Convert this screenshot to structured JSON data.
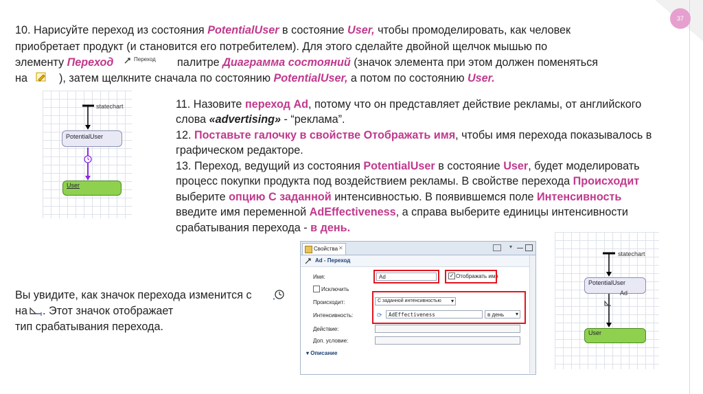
{
  "page": {
    "number": "37"
  },
  "paragraph10": {
    "l1a": "10. Нарисуйте переход из состояния ",
    "l1b": "PotentialUser",
    "l1c": " в состояние ",
    "l1d": "User,",
    "l1e": " чтобы промоделировать, как человек",
    "l2": "приобретает продукт (и становится его потребителем). Для этого сделайте двойной щелчок мышью по",
    "l3a": "элементу ",
    "l3b": "Переход",
    "l3c": "палитре ",
    "l3d": "Диаграмма состояний",
    "l3e": " (значок элемента при этом должен поменяться",
    "l4a": "на",
    "l4b": "), затем щелкните сначала по состоянию ",
    "l4c": "PotentialUser,",
    "l4d": " а потом по состоянию ",
    "l4e": "User."
  },
  "palette": {
    "label": "Переход",
    "icon": "transition-icon",
    "pencil_icon": "pencil-icon"
  },
  "paragraph11": {
    "l1a": "11. Назовите ",
    "l1b": "переход Ad",
    "l1c": ", потому что он представляет действие рекламы, от английского",
    "l2a": "слова ",
    "l2b": "«advertising»",
    "l2c": " - “реклама”.",
    "l3a": "12. ",
    "l3b": "Поставьте галочку в свойстве Отображать имя",
    "l3c": ", чтобы имя перехода показывалось в",
    "l4": "графическом редакторе.",
    "l5a": " 13. Переход, ведущий из состояния ",
    "l5b": "PotentialUser",
    "l5c": " в состояние ",
    "l5d": "User",
    "l5e": ", будет моделировать",
    "l6a": "процесс покупки продукта под воздействием рекламы. В свойстве перехода ",
    "l6b": "Происходит",
    "l7a": "выберите ",
    "l7b": "опцию С заданной",
    "l7c": " интенсивностью. В появившемся поле ",
    "l7d": "Интенсивность",
    "l8a": "введите имя переменной ",
    "l8b": "AdEffectiveness",
    "l8c": ", а справа выберите единицы интенсивности",
    "l9a": "срабатывания перехода - ",
    "l9b": "в день."
  },
  "paragraphIcon": {
    "l1": "Вы увидите, как значок перехода изменится с",
    "l2a": "на",
    "l2b": ". Этот значок отображает",
    "l3": "тип срабатывания перехода."
  },
  "diagram1": {
    "statechart": "statechart",
    "state1": "PotentialUser",
    "state2": "User"
  },
  "diagram2": {
    "statechart": "statechart",
    "state1": "PotentialUser",
    "transition": "Ad",
    "state2": "User"
  },
  "properties": {
    "tab": "Свойства",
    "header": "Ad - Переход",
    "name_label": "Имя:",
    "name_value": "Ad",
    "show_name": "Отображать имя",
    "exclude": "Исключить",
    "trigger_label": "Происходит:",
    "trigger_value": "С заданной интенсивностью",
    "rate_label": "Интенсивность:",
    "rate_value": "AdEffectiveness",
    "rate_unit": "в день",
    "action_label": "Действие:",
    "condition_label": "Доп. условие:",
    "description": "Описание"
  }
}
